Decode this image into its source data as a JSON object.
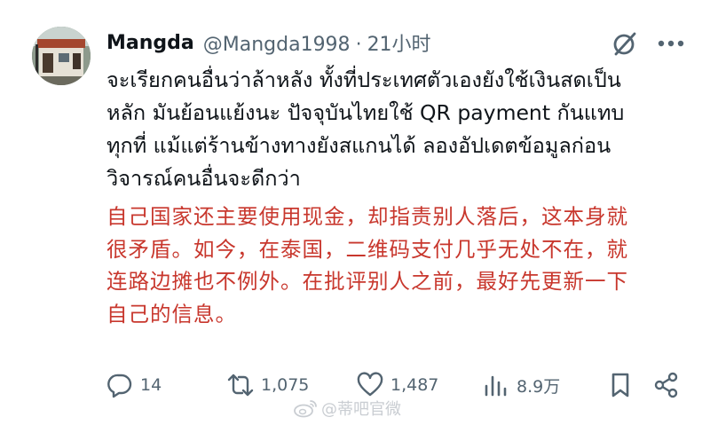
{
  "author": {
    "display_name": "Mangda",
    "handle": "@Mangda1998",
    "separator": "·",
    "time": "21小时"
  },
  "post": {
    "text": "จะเรียกคนอื่นว่าล้าหลัง ทั้งที่ประเทศตัวเองยังใช้เงินสดเป็น\nหลัก มันย้อนแย้งนะ ปัจจุบันไทยใช้ QR payment กันแทบ\nทุกที่ แม้แต่ร้านข้างทางยังสแกนได้ ลองอัปเดตข้อมูลก่อน\nวิจารณ์คนอื่นจะดีกว่า",
    "translation": "自己国家还主要使用现金，却指责别人落后，这本身就\n很矛盾。如今，在泰国，二维码支付几乎无处不在，就\n连路边摊也不例外。在批评别人之前，最好先更新一下\n自己的信息。"
  },
  "actions": {
    "replies": "14",
    "reposts": "1,075",
    "likes": "1,487",
    "views": "8.9万"
  },
  "watermark": {
    "text": "@蒂吧官微"
  },
  "icons": {
    "reply": "reply-icon",
    "repost": "repost-icon",
    "like": "heart-icon",
    "views": "views-icon",
    "bookmark": "bookmark-icon",
    "share": "share-icon",
    "grok": "grok-icon",
    "more": "more-icon",
    "weibo": "weibo-icon"
  },
  "colors": {
    "text": "#0f1419",
    "secondary": "#536471",
    "translation": "#c8372d",
    "watermark": "#c9cdd2"
  }
}
